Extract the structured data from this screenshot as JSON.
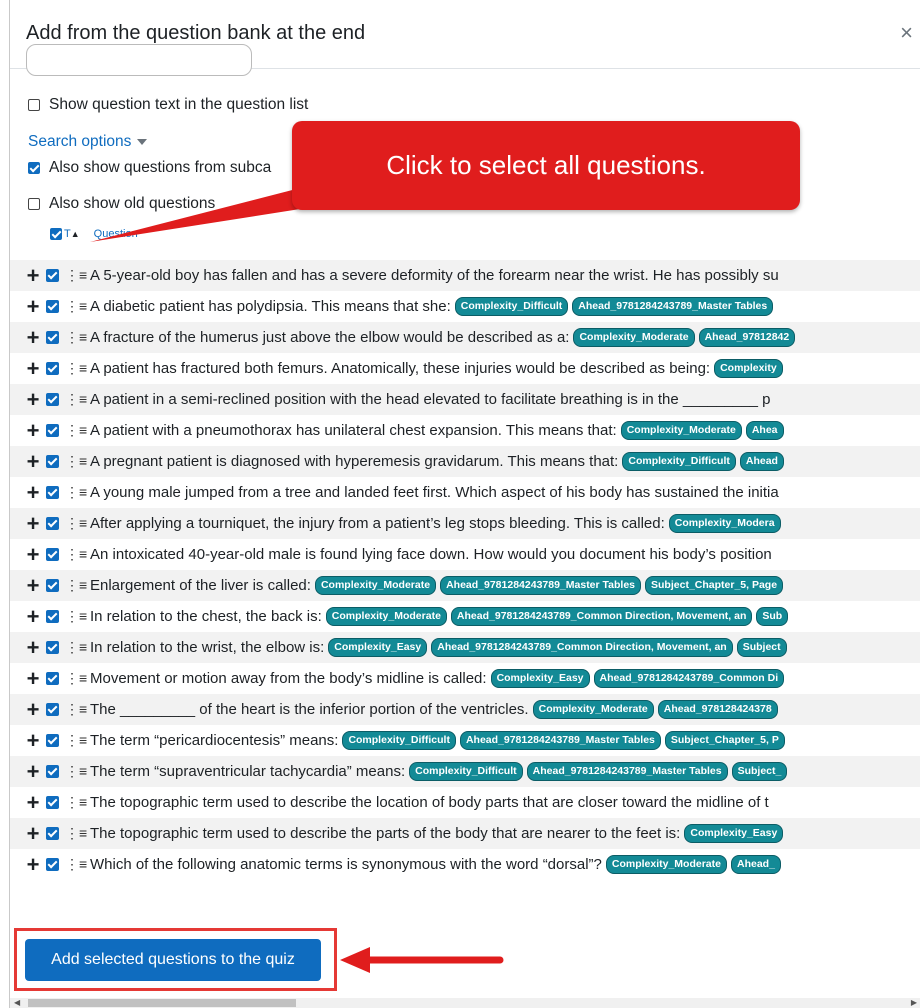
{
  "modal": {
    "title": "Add from the question bank at the end",
    "close": "×"
  },
  "options": {
    "show_text": "Show question text in the question list",
    "search_options": "Search options",
    "subcats": "Also show questions from subca",
    "old": "Also show old questions"
  },
  "table_header": {
    "type": "T",
    "question": "Question"
  },
  "callout": "Click to select all questions.",
  "questions": [
    {
      "text": "A 5-year-old boy has fallen and has a severe deformity of the forearm near the wrist. He has possibly su",
      "tags": []
    },
    {
      "text": "A diabetic patient has polydipsia. This means that she:",
      "tags": [
        "Complexity_Difficult",
        "Ahead_9781284243789_Master Tables"
      ]
    },
    {
      "text": "A fracture of the humerus just above the elbow would be described as a:",
      "tags": [
        "Complexity_Moderate",
        "Ahead_97812842"
      ]
    },
    {
      "text": "A patient has fractured both femurs. Anatomically, these injuries would be described as being:",
      "tags": [
        "Complexity"
      ]
    },
    {
      "text": "A patient in a semi-reclined position with the head elevated to facilitate breathing is in the _________ p",
      "tags": []
    },
    {
      "text": "A patient with a pneumothorax has unilateral chest expansion. This means that:",
      "tags": [
        "Complexity_Moderate",
        "Ahea"
      ]
    },
    {
      "text": "A pregnant patient is diagnosed with hyperemesis gravidarum. This means that:",
      "tags": [
        "Complexity_Difficult",
        "Ahead"
      ]
    },
    {
      "text": "A young male jumped from a tree and landed feet first. Which aspect of his body has sustained the initia",
      "tags": []
    },
    {
      "text": "After applying a tourniquet, the injury from a patient’s leg stops bleeding. This is called:",
      "tags": [
        "Complexity_Modera"
      ]
    },
    {
      "text": "An intoxicated 40-year-old male is found lying face down. How would you document his body’s position",
      "tags": []
    },
    {
      "text": "Enlargement of the liver is called:",
      "tags": [
        "Complexity_Moderate",
        "Ahead_9781284243789_Master Tables",
        "Subject_Chapter_5, Page"
      ]
    },
    {
      "text": "In relation to the chest, the back is:",
      "tags": [
        "Complexity_Moderate",
        "Ahead_9781284243789_Common Direction, Movement, an",
        "Sub"
      ]
    },
    {
      "text": "In relation to the wrist, the elbow is:",
      "tags": [
        "Complexity_Easy",
        "Ahead_9781284243789_Common Direction, Movement, an",
        "Subject"
      ]
    },
    {
      "text": "Movement or motion away from the body’s midline is called:",
      "tags": [
        "Complexity_Easy",
        "Ahead_9781284243789_Common Di"
      ]
    },
    {
      "text": "The _________ of the heart is the inferior portion of the ventricles.",
      "tags": [
        "Complexity_Moderate",
        "Ahead_978128424378"
      ]
    },
    {
      "text": "The term “pericardiocentesis” means:",
      "tags": [
        "Complexity_Difficult",
        "Ahead_9781284243789_Master Tables",
        "Subject_Chapter_5, P"
      ]
    },
    {
      "text": "The term “supraventricular tachycardia” means:",
      "tags": [
        "Complexity_Difficult",
        "Ahead_9781284243789_Master Tables",
        "Subject_"
      ]
    },
    {
      "text": "The topographic term used to describe the location of body parts that are closer toward the midline of t",
      "tags": []
    },
    {
      "text": "The topographic term used to describe the parts of the body that are nearer to the feet is:",
      "tags": [
        "Complexity_Easy"
      ]
    },
    {
      "text": "Which of the following anatomic terms is synonymous with the word “dorsal”?",
      "tags": [
        "Complexity_Moderate",
        "Ahead_"
      ]
    }
  ],
  "footer": {
    "add_button": "Add selected questions to the quiz"
  },
  "colors": {
    "brand": "#0f6cbf",
    "tag": "#138a96",
    "callout": "#e01d1d"
  }
}
